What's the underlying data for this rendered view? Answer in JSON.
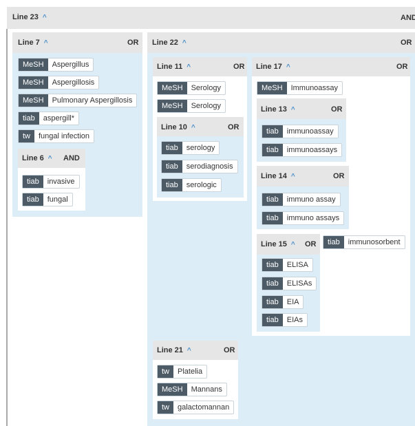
{
  "groups": {
    "l23": {
      "label": "Line 23",
      "op": "AND"
    },
    "l7": {
      "label": "Line 7",
      "op": "OR"
    },
    "l6": {
      "label": "Line 6",
      "op": "AND"
    },
    "l22": {
      "label": "Line 22",
      "op": "OR"
    },
    "l11": {
      "label": "Line 11",
      "op": "OR"
    },
    "l10": {
      "label": "Line 10",
      "op": "OR"
    },
    "l17": {
      "label": "Line 17",
      "op": "OR"
    },
    "l13": {
      "label": "Line 13",
      "op": "OR"
    },
    "l14": {
      "label": "Line 14",
      "op": "OR"
    },
    "l15": {
      "label": "Line 15",
      "op": "OR"
    },
    "l21": {
      "label": "Line 21",
      "op": "OR"
    }
  },
  "terms": {
    "t1": {
      "tag": "MeSH",
      "text": "Aspergillus"
    },
    "t2": {
      "tag": "MeSH",
      "text": "Aspergillosis"
    },
    "t3": {
      "tag": "MeSH",
      "text": "Pulmonary Aspergillosis"
    },
    "t4": {
      "tag": "tiab",
      "text": "aspergill*"
    },
    "t5": {
      "tag": "tw",
      "text": "fungal infection"
    },
    "t6": {
      "tag": "tiab",
      "text": "invasive"
    },
    "t7": {
      "tag": "tiab",
      "text": "fungal"
    },
    "t8": {
      "tag": "MeSH",
      "text": "Serology"
    },
    "t9": {
      "tag": "MeSH",
      "text": "Serology"
    },
    "t10": {
      "tag": "tiab",
      "text": "serology"
    },
    "t11": {
      "tag": "tiab",
      "text": "serodiagnosis"
    },
    "t12": {
      "tag": "tiab",
      "text": "serologic"
    },
    "t13": {
      "tag": "MeSH",
      "text": "Immunoassay"
    },
    "t14": {
      "tag": "tiab",
      "text": "immunoassay"
    },
    "t15": {
      "tag": "tiab",
      "text": "immunoassays"
    },
    "t16": {
      "tag": "tiab",
      "text": "immuno assay"
    },
    "t17": {
      "tag": "tiab",
      "text": "immuno assays"
    },
    "t18": {
      "tag": "tiab",
      "text": "ELISA"
    },
    "t19": {
      "tag": "tiab",
      "text": "ELISAs"
    },
    "t20": {
      "tag": "tiab",
      "text": "EIA"
    },
    "t21": {
      "tag": "tiab",
      "text": "EIAs"
    },
    "t22": {
      "tag": "tiab",
      "text": "immunosorbent"
    },
    "t23": {
      "tag": "tw",
      "text": "Platelia"
    },
    "t24": {
      "tag": "MeSH",
      "text": "Mannans"
    },
    "t25": {
      "tag": "tw",
      "text": "galactomannan"
    }
  },
  "icons": {
    "collapse": "chevron-up-icon"
  }
}
